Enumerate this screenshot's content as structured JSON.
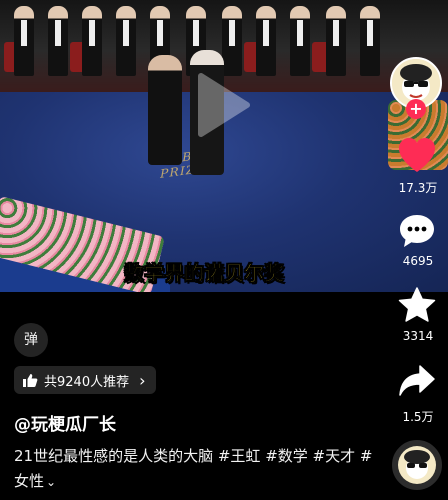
{
  "video": {
    "floor_logo": "NOBEL PRIZE",
    "caption": "数学界的诺贝尔奖"
  },
  "actions": {
    "likes": "17.3万",
    "comments": "4695",
    "favorites": "3314",
    "shares": "1.5万",
    "follow_symbol": "+"
  },
  "danmaku": {
    "label": "弹"
  },
  "recommend": {
    "label": "共9240人推荐",
    "icon": "thumb-up-icon",
    "chevron": "›"
  },
  "post": {
    "author": "@玩梗瓜厂长",
    "description": "21世纪最性感的是人类的大脑 #王虹 #数学 #天才 #女性",
    "more_symbol": "⌄"
  },
  "colors": {
    "like_red": "#fe2c55",
    "caption_yellow": "#ffe234",
    "background": "#000000"
  }
}
